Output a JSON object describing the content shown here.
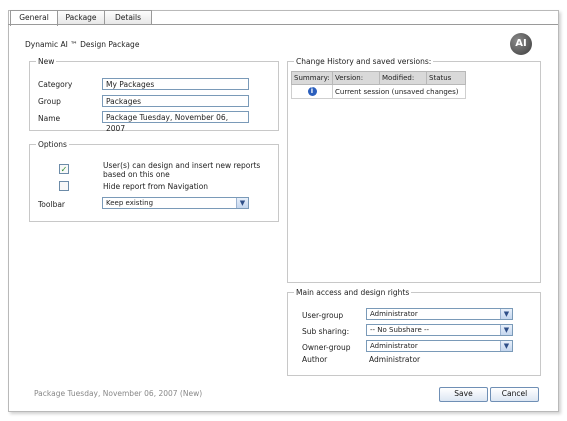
{
  "tabs": [
    {
      "label": "General"
    },
    {
      "label": "Package"
    },
    {
      "label": "Details"
    }
  ],
  "title": "Dynamic AI ™ Design Package",
  "logo_text": "AI",
  "new_section": {
    "legend": "New",
    "category_label": "Category",
    "category_value": "My Packages",
    "group_label": "Group",
    "group_value": "Packages",
    "name_label": "Name",
    "name_value": "Package Tuesday, November 06, 2007"
  },
  "options_section": {
    "legend": "Options",
    "option1_label": "User(s) can design and insert new reports",
    "option1_label_line2": "based on this one",
    "option1_checked": true,
    "option2_label": "Hide report from Navigation",
    "option2_checked": false,
    "toolbar_label": "Toolbar",
    "toolbar_value": "Keep existing"
  },
  "history_section": {
    "legend": "Change History and saved versions:",
    "columns": [
      "Summary:",
      "Version:",
      "Modified:",
      "Status"
    ],
    "row_text": "Current session (unsaved changes)"
  },
  "access_section": {
    "legend": "Main access and design rights",
    "user_group_label": "User-group",
    "user_group_value": "Administrator",
    "sub_sharing_label": "Sub sharing:",
    "sub_sharing_value": "-- No Subshare --",
    "owner_group_label": "Owner-group",
    "owner_group_value": "Administrator",
    "author_label": "Author",
    "author_value": "Administrator"
  },
  "footer_text": "Package Tuesday, November 06, 2007 (New)",
  "buttons": {
    "save": "Save",
    "cancel": "Cancel"
  },
  "colors": {
    "input_border": "#7a9ab8",
    "info_icon": "#2b5fbd",
    "check_mark": "#2a8a2a"
  }
}
